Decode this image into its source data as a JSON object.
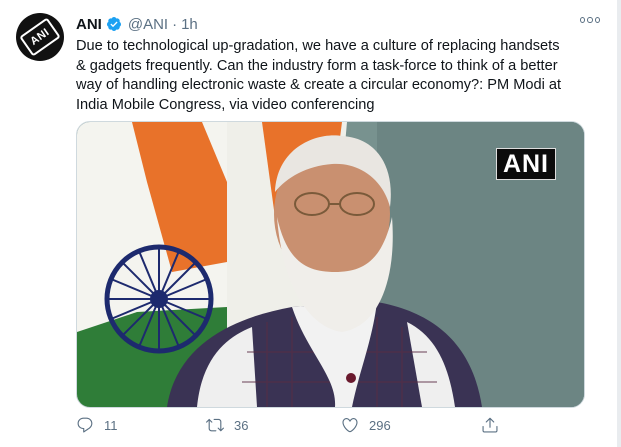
{
  "tweet": {
    "author_name": "ANI",
    "handle": "@ANI",
    "separator": "·",
    "time": "1h",
    "avatar_text": "ANI",
    "text_lines": [
      "Due to technological up-gradation, we have a culture of replacing handsets",
      "& gadgets frequently. Can the industry form a task-force to think of a better",
      "way of handling electronic waste & create a circular economy?: PM Modi at",
      "India Mobile Congress, via video conferencing"
    ],
    "media": {
      "watermark": "ANI"
    },
    "actions": {
      "reply_count": "11",
      "retweet_count": "36",
      "like_count": "296"
    }
  },
  "colors": {
    "verified_blue": "#1da1f2",
    "secondary_text": "#5b7083",
    "flag_saffron": "#e8722a",
    "flag_green": "#2f7d38",
    "chakra_navy": "#1d2a6e"
  },
  "icons": [
    "verified-badge-icon",
    "more-options-icon",
    "reply-icon",
    "retweet-icon",
    "like-icon",
    "share-icon"
  ]
}
